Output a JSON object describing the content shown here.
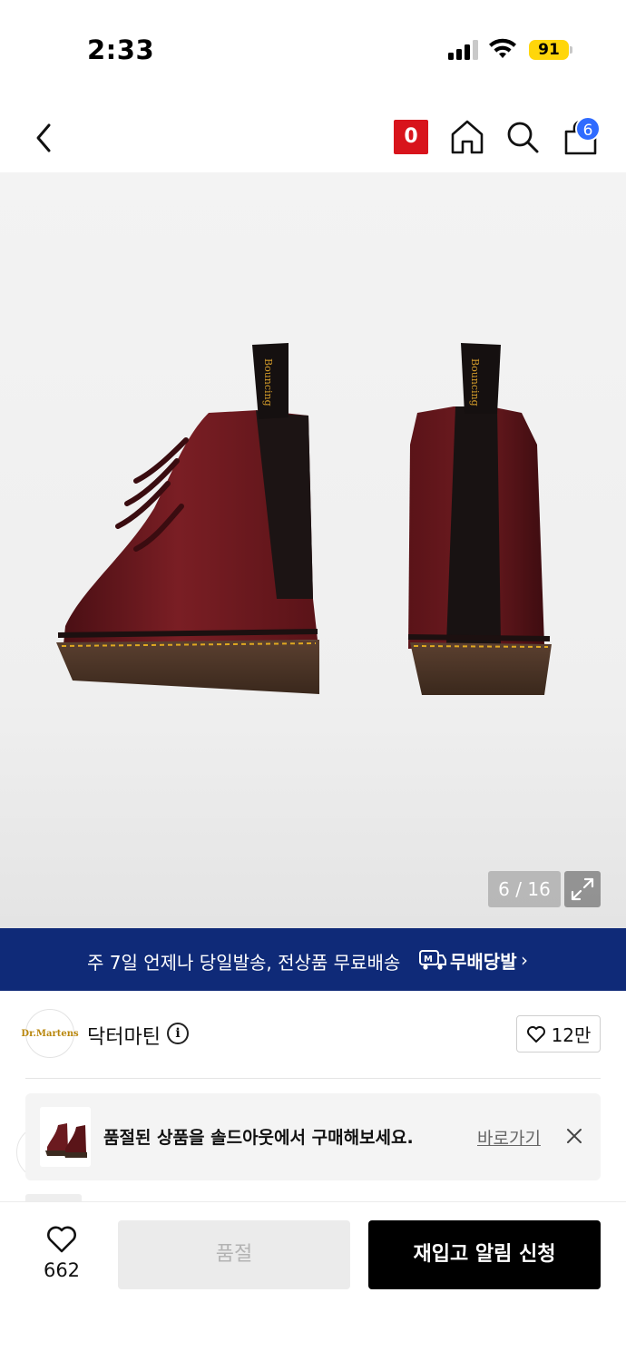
{
  "status_bar": {
    "time": "2:33",
    "battery": "91"
  },
  "header": {
    "back_icon": "chevron-left-icon",
    "musinsa_badge": "0",
    "home_icon": "home-icon",
    "search_icon": "search-icon",
    "cart_icon": "shopping-bag-icon",
    "cart_count": "6"
  },
  "gallery": {
    "counter": "6 / 16",
    "current": 6,
    "total": 16,
    "expand_icon": "expand-icon"
  },
  "delivery_banner": {
    "text": "주 7일 언제나 당일발송, 전상품 무료배송",
    "logo_text": "무배당발",
    "logo_mark": "M",
    "chevron": "›"
  },
  "brand": {
    "logo_text": "Dr.Martens",
    "name": "닥터마틴",
    "info_icon": "i",
    "like_count": "12만"
  },
  "notice": {
    "text": "품절된 상품을 솔드아웃에서 구매해보세요.",
    "link": "바로가기",
    "close": "×"
  },
  "bottom_bar": {
    "wish_count": "662",
    "soldout_label": "품절",
    "restock_label": "재입고 알림 신청"
  },
  "colors": {
    "banner_bg": "#0f2a78",
    "musinsa_red": "#d8141c",
    "badge_blue": "#2f6bff",
    "battery_yellow": "#ffd60a",
    "boot_leather": "#6e1b1f"
  }
}
